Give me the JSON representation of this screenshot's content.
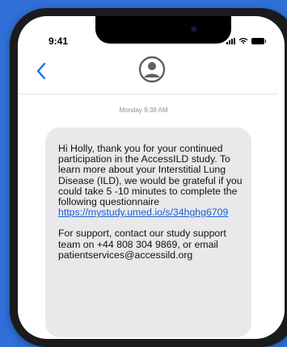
{
  "status_bar": {
    "time": "9:41"
  },
  "header": {
    "back_icon": "chevron-left-icon",
    "avatar_icon": "person-circle-icon"
  },
  "thread": {
    "timestamp": "Monday 9:38 AM",
    "message": {
      "intro": "Hi Holly, thank you for your continued participation in the AccessILD study. To learn more about your Interstitial Lung Disease (ILD), we would be grateful if you could take 5 -10 minutes to complete the following questionnaire",
      "link": "https://mystudy.umed.io/s/34hghg6709",
      "support": "For support, contact our study support team on +44 808 304 9869, or email",
      "email": "patientservices@accessild.org"
    }
  },
  "colors": {
    "background": "#2f6fd6",
    "bubble": "#e9e9eb",
    "accent": "#1a5fd6"
  }
}
